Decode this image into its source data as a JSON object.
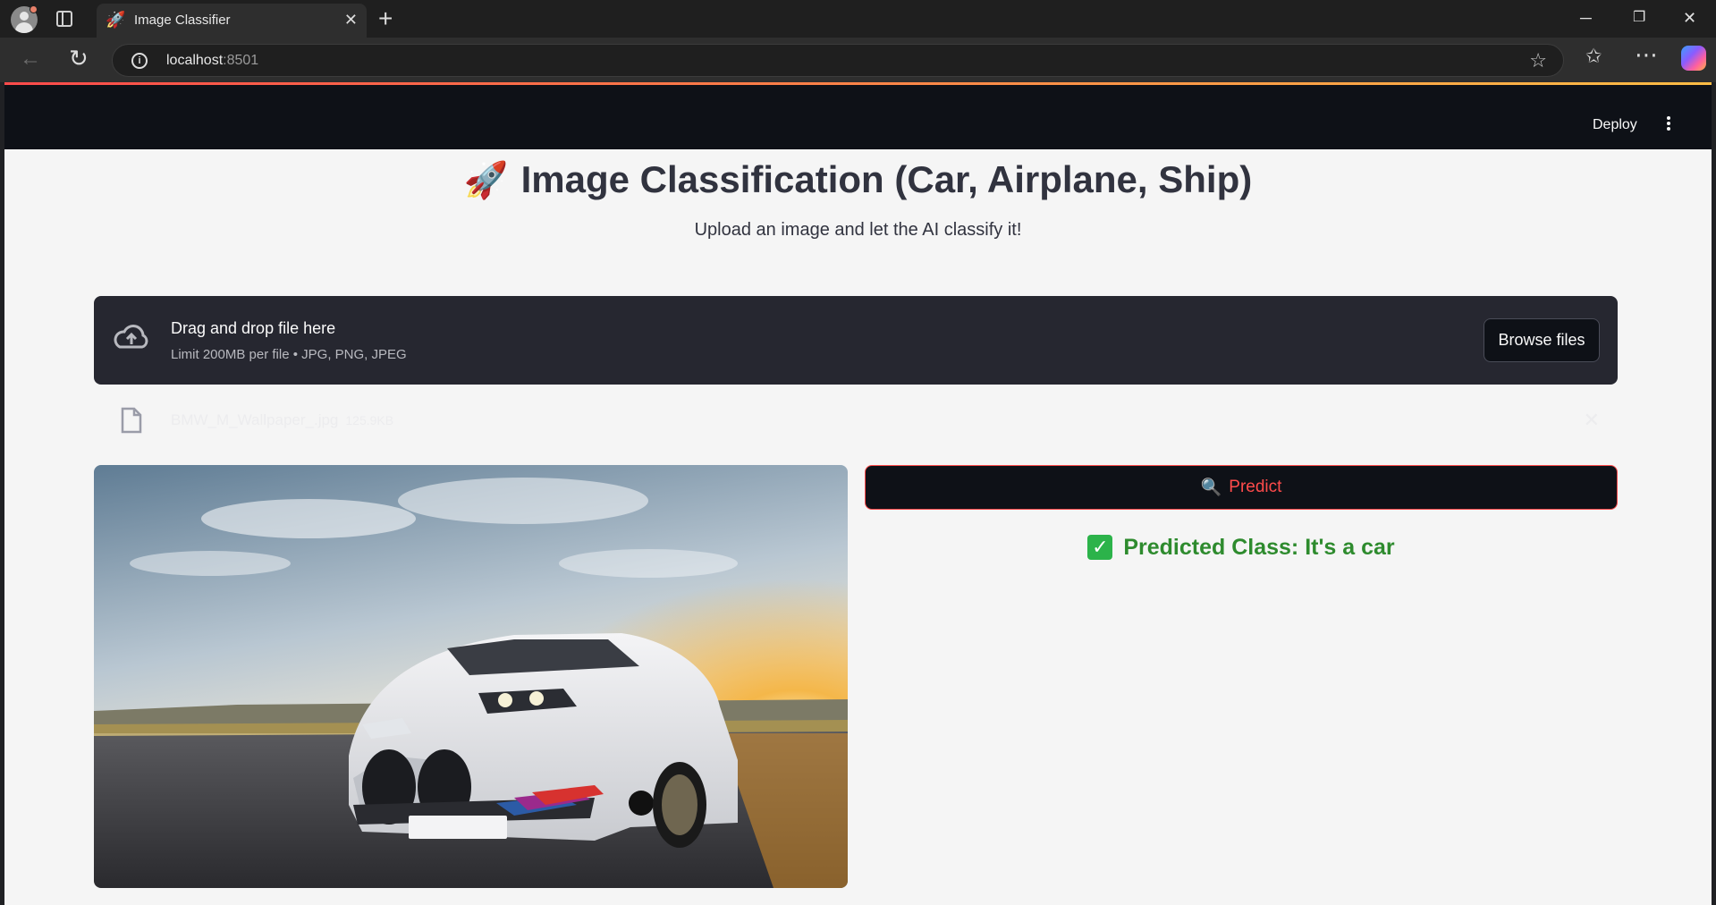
{
  "browser": {
    "tab_title": "Image Classifier",
    "tab_favicon": "🚀",
    "url_host": "localhost",
    "url_port": ":8501"
  },
  "header": {
    "deploy_label": "Deploy"
  },
  "page": {
    "title_emoji": "🚀",
    "title": "Image Classification (Car, Airplane, Ship)",
    "subtitle": "Upload an image and let the AI classify it!"
  },
  "uploader": {
    "main_text": "Drag and drop file here",
    "sub_text": "Limit 200MB per file • JPG, PNG, JPEG",
    "browse_label": "Browse files",
    "file_name": "BMW_M_Wallpaper_.jpg",
    "file_size": "125.9KB"
  },
  "actions": {
    "predict_emoji": "🔍",
    "predict_label": "Predict"
  },
  "result": {
    "check": "✓",
    "text": "Predicted Class: It's a car"
  },
  "colors": {
    "accent": "#ff4b4b",
    "success": "#2e8b2e",
    "header_bg": "#0e1117",
    "uploader_bg": "#262730"
  },
  "icons": [
    "profile-icon",
    "tab-actions-icon",
    "close-icon",
    "plus-icon",
    "back-icon",
    "reload-icon",
    "info-icon",
    "star-icon",
    "favorites-icon",
    "more-icon",
    "copilot-icon",
    "kebab-icon",
    "cloud-upload-icon",
    "file-icon",
    "magnifier-icon",
    "check-icon"
  ]
}
